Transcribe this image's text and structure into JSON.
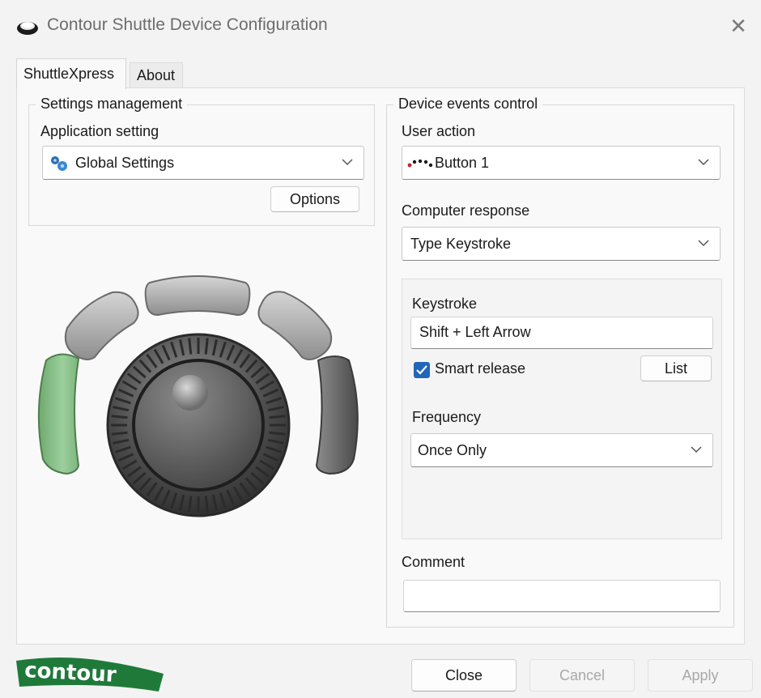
{
  "window": {
    "title": "Contour Shuttle Device Configuration",
    "close_glyph": "✕"
  },
  "tabs": [
    {
      "label": "ShuttleXpress",
      "active": true
    },
    {
      "label": "About",
      "active": false
    }
  ],
  "settings_management": {
    "group_title": "Settings management",
    "application_setting_label": "Application setting",
    "application_setting_value": "Global Settings",
    "options_label": "Options"
  },
  "device_events": {
    "group_title": "Device events control",
    "user_action_label": "User action",
    "user_action_value": "Button 1",
    "computer_response_label": "Computer response",
    "computer_response_value": "Type Keystroke",
    "keystroke_label": "Keystroke",
    "keystroke_value": "Shift + Left Arrow",
    "smart_release_label": "Smart release",
    "smart_release_checked": true,
    "list_label": "List",
    "frequency_label": "Frequency",
    "frequency_value": "Once Only",
    "comment_label": "Comment",
    "comment_value": ""
  },
  "device_image": {
    "highlighted_button": "Button 1",
    "highlight_color": "#8fc48f"
  },
  "footer": {
    "close_label": "Close",
    "cancel_label": "Cancel",
    "apply_label": "Apply",
    "logo_text": "contour",
    "logo_color": "#1f7a3a"
  },
  "colors": {
    "accent": "#2166b8",
    "window_bg": "#f3f3f3",
    "panel_bg": "#f9f9f9"
  }
}
